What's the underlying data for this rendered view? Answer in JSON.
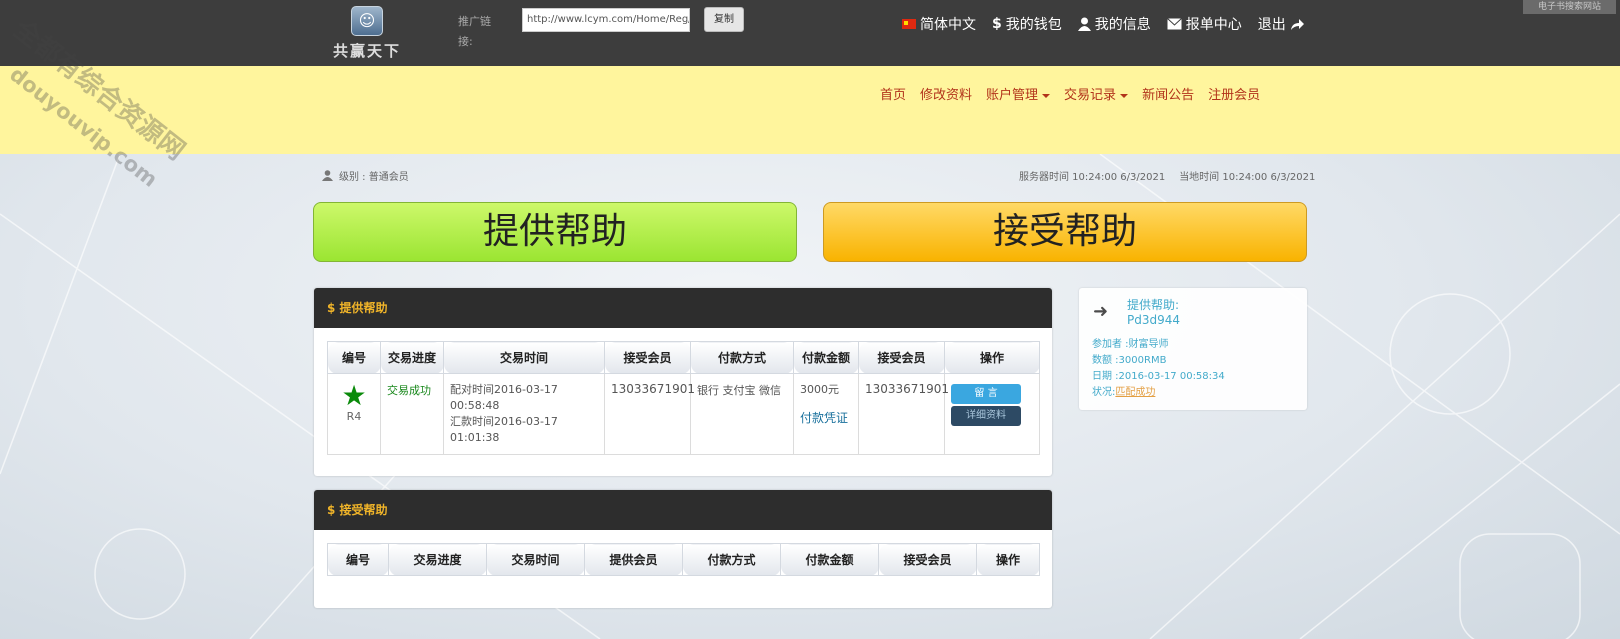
{
  "logo": {
    "icon": "finder-icon",
    "text": "共赢天下"
  },
  "top_bar": {
    "ref_label": "推广链接:",
    "ref_url": "http://www.lcym.com/Home/Reg/index",
    "copy_label": "复制",
    "nav": [
      {
        "icon": "china-flag-icon",
        "label": "简体中文"
      },
      {
        "icon": "dollar-icon",
        "label": "我的钱包"
      },
      {
        "icon": "user-icon",
        "label": "我的信息"
      },
      {
        "icon": "envelope-icon",
        "label": "报单中心"
      },
      {
        "icon": "share-arrow-icon",
        "label": "退出"
      }
    ],
    "corner_tag": "电子书搜索网站"
  },
  "main_nav": [
    "首页",
    "修改资料",
    "账户管理",
    "交易记录",
    "新闻公告",
    "注册会员"
  ],
  "info": {
    "level": "级别 : 普通会员",
    "server_time": "服务器时间  10:24:00 6/3/2021",
    "local_time": "当地时间  10:24:00 6/3/2021"
  },
  "big_buttons": {
    "provide": "提供帮助",
    "accept": "接受帮助"
  },
  "provide_panel": {
    "title": "$ 提供帮助",
    "headers": [
      "编号",
      "交易进度",
      "交易时间",
      "接受会员",
      "付款方式",
      "付款金额",
      "接受会员",
      "操作"
    ],
    "row": {
      "level": "R4",
      "status": "交易成功",
      "time_match": "配对时间2016-03-17 00:58:48",
      "time_pay": "汇款时间2016-03-17 01:01:38",
      "receiver": "13033671901",
      "pay_methods": "银行 支付宝 微信",
      "amount": "3000元",
      "voucher": "付款凭证",
      "receiver2": "13033671901",
      "btn_message": "留 言",
      "btn_detail": "详细资料"
    }
  },
  "accept_panel": {
    "title": "$ 接受帮助",
    "headers": [
      "编号",
      "交易进度",
      "交易时间",
      "提供会员",
      "付款方式",
      "付款金额",
      "接受会员",
      "操作"
    ]
  },
  "side_card": {
    "title": "提供帮助:",
    "code": "Pd3d944",
    "participant": "参加者 :财富导师",
    "amount": "数额 :3000RMB",
    "date": "日期 :2016-03-17 00:58:34",
    "status_label": "状况:",
    "status_value": "匹配成功"
  },
  "watermark": {
    "cn": "全都有综合资源网",
    "en": "douyouvip.com"
  }
}
